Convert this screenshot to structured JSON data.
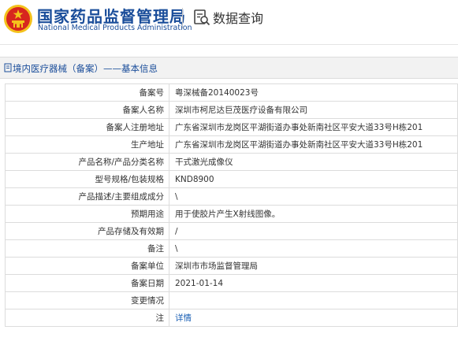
{
  "header": {
    "org_name_cn": "国家药品监督管理局",
    "org_name_en": "National Medical Products Administration",
    "section_title": "数据查询"
  },
  "page_title": "境内医疗器械（备案）——基本信息",
  "colors": {
    "brand_blue": "#1a4d9a",
    "link_blue": "#1a5fb4",
    "emblem_red": "#d7261e",
    "emblem_gold": "#f4c21c"
  },
  "rows": [
    {
      "label": "备案号",
      "value": "粤深械备20140023号"
    },
    {
      "label": "备案人名称",
      "value": "深圳市柯尼达巨茂医疗设备有限公司"
    },
    {
      "label": "备案人注册地址",
      "value": "广东省深圳市龙岗区平湖街道办事处新南社区平安大道33号H栋201"
    },
    {
      "label": "生产地址",
      "value": "广东省深圳市龙岗区平湖街道办事处新南社区平安大道33号H栋201"
    },
    {
      "label": "产品名称/产品分类名称",
      "value": "干式激光成像仪"
    },
    {
      "label": "型号规格/包装规格",
      "value": "KND8900"
    },
    {
      "label": "产品描述/主要组成成分",
      "value": "\\"
    },
    {
      "label": "预期用途",
      "value": "用于使胶片产生X射线图像。"
    },
    {
      "label": "产品存储及有效期",
      "value": "/"
    },
    {
      "label": "备注",
      "value": "\\"
    },
    {
      "label": "备案单位",
      "value": "深圳市市场监督管理局"
    },
    {
      "label": "备案日期",
      "value": "2021-01-14"
    },
    {
      "label": "变更情况",
      "value": ""
    },
    {
      "label": "注",
      "value": "详情",
      "link": true
    }
  ]
}
